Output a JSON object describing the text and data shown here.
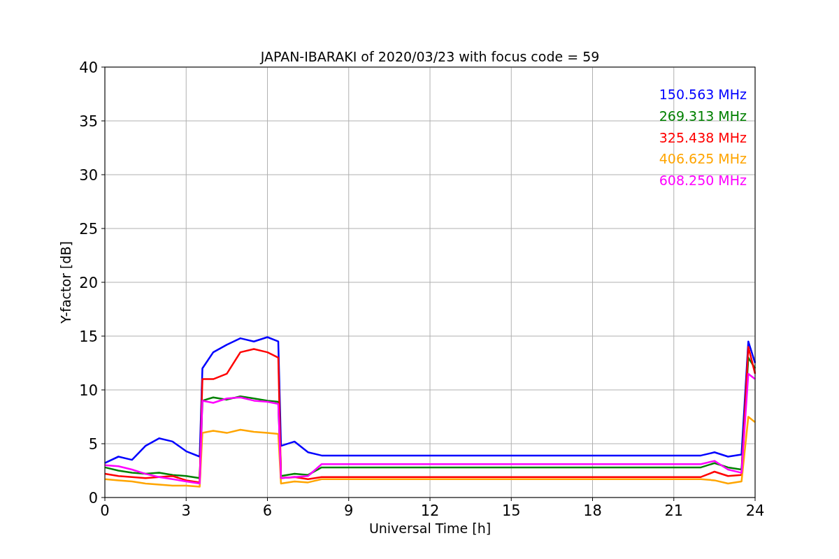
{
  "figure": {
    "chart_data": {
      "type": "line",
      "title": "JAPAN-IBARAKI of 2020/03/23 with focus code = 59",
      "xlabel": "Universal Time [h]",
      "ylabel": "Y-factor [dB]",
      "x": [
        0,
        0.5,
        1,
        1.5,
        2,
        2.5,
        3,
        3.5,
        3.6,
        4,
        4.5,
        5,
        5.5,
        6,
        6.4,
        6.5,
        7,
        7.5,
        8,
        22,
        22.5,
        23,
        23.5,
        23.75,
        24
      ],
      "series": [
        {
          "name": "150.563 MHz",
          "color": "#0000ff",
          "values": [
            3.2,
            3.8,
            3.5,
            4.8,
            5.5,
            5.2,
            4.3,
            3.8,
            12,
            13.5,
            14.2,
            14.8,
            14.5,
            14.9,
            14.5,
            4.8,
            5.2,
            4.2,
            3.9,
            3.9,
            4.2,
            3.8,
            4.0,
            14.5,
            12.5
          ]
        },
        {
          "name": "269.313 MHz",
          "color": "#008000",
          "values": [
            2.8,
            2.5,
            2.3,
            2.2,
            2.3,
            2.1,
            2.0,
            1.8,
            9,
            9.3,
            9.1,
            9.4,
            9.2,
            9.0,
            8.9,
            2.0,
            2.2,
            2.1,
            2.8,
            2.8,
            3.2,
            2.8,
            2.6,
            13,
            12
          ]
        },
        {
          "name": "325.438 MHz",
          "color": "#ff0000",
          "values": [
            2.2,
            2.0,
            1.9,
            1.8,
            1.9,
            2.0,
            1.6,
            1.4,
            11,
            11,
            11.5,
            13.5,
            13.8,
            13.5,
            13,
            1.8,
            1.9,
            1.7,
            1.9,
            1.9,
            2.4,
            2.0,
            2.1,
            14,
            11.5
          ]
        },
        {
          "name": "406.625 MHz",
          "color": "#ffa500",
          "values": [
            1.7,
            1.6,
            1.5,
            1.3,
            1.2,
            1.1,
            1.1,
            1.0,
            6,
            6.2,
            6.0,
            6.3,
            6.1,
            6.0,
            5.9,
            1.3,
            1.5,
            1.4,
            1.7,
            1.7,
            1.6,
            1.3,
            1.5,
            7.5,
            7
          ]
        },
        {
          "name": "608.250 MHz",
          "color": "#ff00ff",
          "values": [
            3.0,
            2.9,
            2.6,
            2.2,
            1.9,
            1.7,
            1.5,
            1.3,
            9,
            8.8,
            9.2,
            9.3,
            9.0,
            8.9,
            8.7,
            1.8,
            1.9,
            2.0,
            3.1,
            3.1,
            3.4,
            2.6,
            2.3,
            11.5,
            11
          ]
        }
      ],
      "grid": true,
      "xlim": [
        0,
        24
      ],
      "ylim": [
        0,
        40
      ],
      "xticks": [
        0,
        3,
        6,
        9,
        12,
        15,
        18,
        21,
        24
      ],
      "yticks": [
        0,
        5,
        10,
        15,
        20,
        25,
        30,
        35,
        40
      ]
    }
  }
}
